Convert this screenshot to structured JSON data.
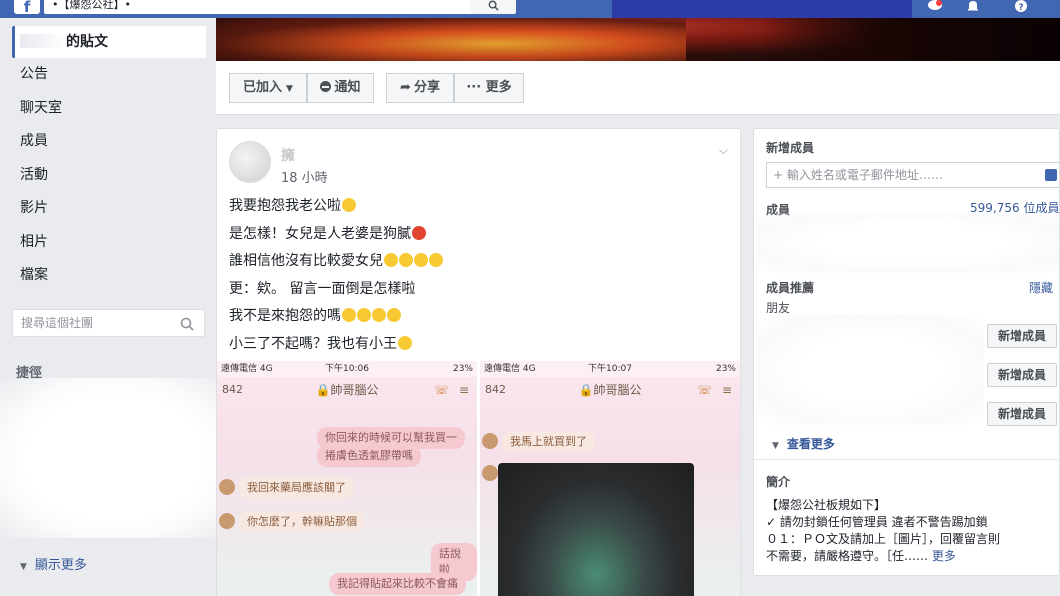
{
  "topbar": {
    "logo": "f",
    "search_value": "•【爆怨公社】•",
    "search_icon": "search-icon",
    "icons": [
      "messenger-icon",
      "bell-icon",
      "help-icon"
    ]
  },
  "sidebar": {
    "items": [
      {
        "label": "的貼文",
        "active": true
      },
      {
        "label": "公告"
      },
      {
        "label": "聊天室"
      },
      {
        "label": "成員"
      },
      {
        "label": "活動"
      },
      {
        "label": "影片"
      },
      {
        "label": "相片"
      },
      {
        "label": "檔案"
      }
    ],
    "search_placeholder": "搜尋這個社團",
    "shortcuts_title": "捷徑",
    "show_more": "顯示更多"
  },
  "actions": {
    "joined": "已加入",
    "notify": "通知",
    "share": "分享",
    "more": "··· 更多"
  },
  "post": {
    "author": "擁",
    "time": "18 小時",
    "lines": [
      {
        "text": "我要抱怨我老公啦",
        "emoji": [
          "smile"
        ]
      },
      {
        "text": "是怎樣！女兒是人老婆是狗膩",
        "emoji": [
          "angry"
        ]
      },
      {
        "text": "誰相信他沒有比較愛女兒",
        "emoji": [
          "smile",
          "smile",
          "smile",
          "smile"
        ]
      },
      {
        "text": "更：欸。 留言一面倒是怎樣啦",
        "emoji": []
      },
      {
        "text": "我不是來抱怨的嗎",
        "emoji": [
          "smile",
          "smile",
          "smile",
          "smile"
        ]
      },
      {
        "text": "小三了不起嗎？我也有小王",
        "emoji": [
          "smile"
        ]
      }
    ],
    "screenshots": [
      {
        "carrier": "遠傳電信  4G",
        "time": "下午10:06",
        "status_right": "23%",
        "chat_name": "🔒帥哥腦公",
        "count": "842",
        "bubbles": [
          {
            "dir": "out",
            "text": "你回來的時候可以幫我買一"
          },
          {
            "dir": "out",
            "text": "捲膚色透氣膠帶嗎"
          },
          {
            "dir": "in",
            "text": "我回來藥局應該關了"
          },
          {
            "dir": "in",
            "text": "你怎麼了，幹嘛貼那個"
          },
          {
            "dir": "out",
            "text": "話說啦"
          },
          {
            "dir": "out",
            "text": "我記得貼起來比較不會痛"
          }
        ]
      },
      {
        "carrier": "遠傳電信  4G",
        "time": "下午10:07",
        "status_right": "23%",
        "chat_name": "🔒帥哥腦公",
        "count": "842",
        "bubbles": [
          {
            "dir": "in",
            "text": "我馬上就買到了"
          }
        ]
      }
    ]
  },
  "right": {
    "add_member_title": "新增成員",
    "add_input_placeholder": "+ 輸入姓名或電子郵件地址……",
    "members_title": "成員",
    "members_count": "599,756 位成員",
    "suggestions_title": "成員推薦",
    "hide_label": "隱藏",
    "friends_label": "朋友",
    "add_buttons": [
      "新增成員",
      "新增成員",
      "新增成員"
    ],
    "see_more": "查看更多",
    "intro_title": "簡介",
    "intro_lines": [
      "【爆怨公社板規如下】",
      "✓ 請勿封鎖任何管理員 違者不警告踢加鎖",
      "０１：ＰＯ文及請加上［圖片］，回覆留言則",
      "不需要，請嚴格遵守。［任……"
    ],
    "intro_more": "更多"
  },
  "colors": {
    "brand": "#4267b2",
    "link": "#365899",
    "background": "#e9ebee"
  }
}
